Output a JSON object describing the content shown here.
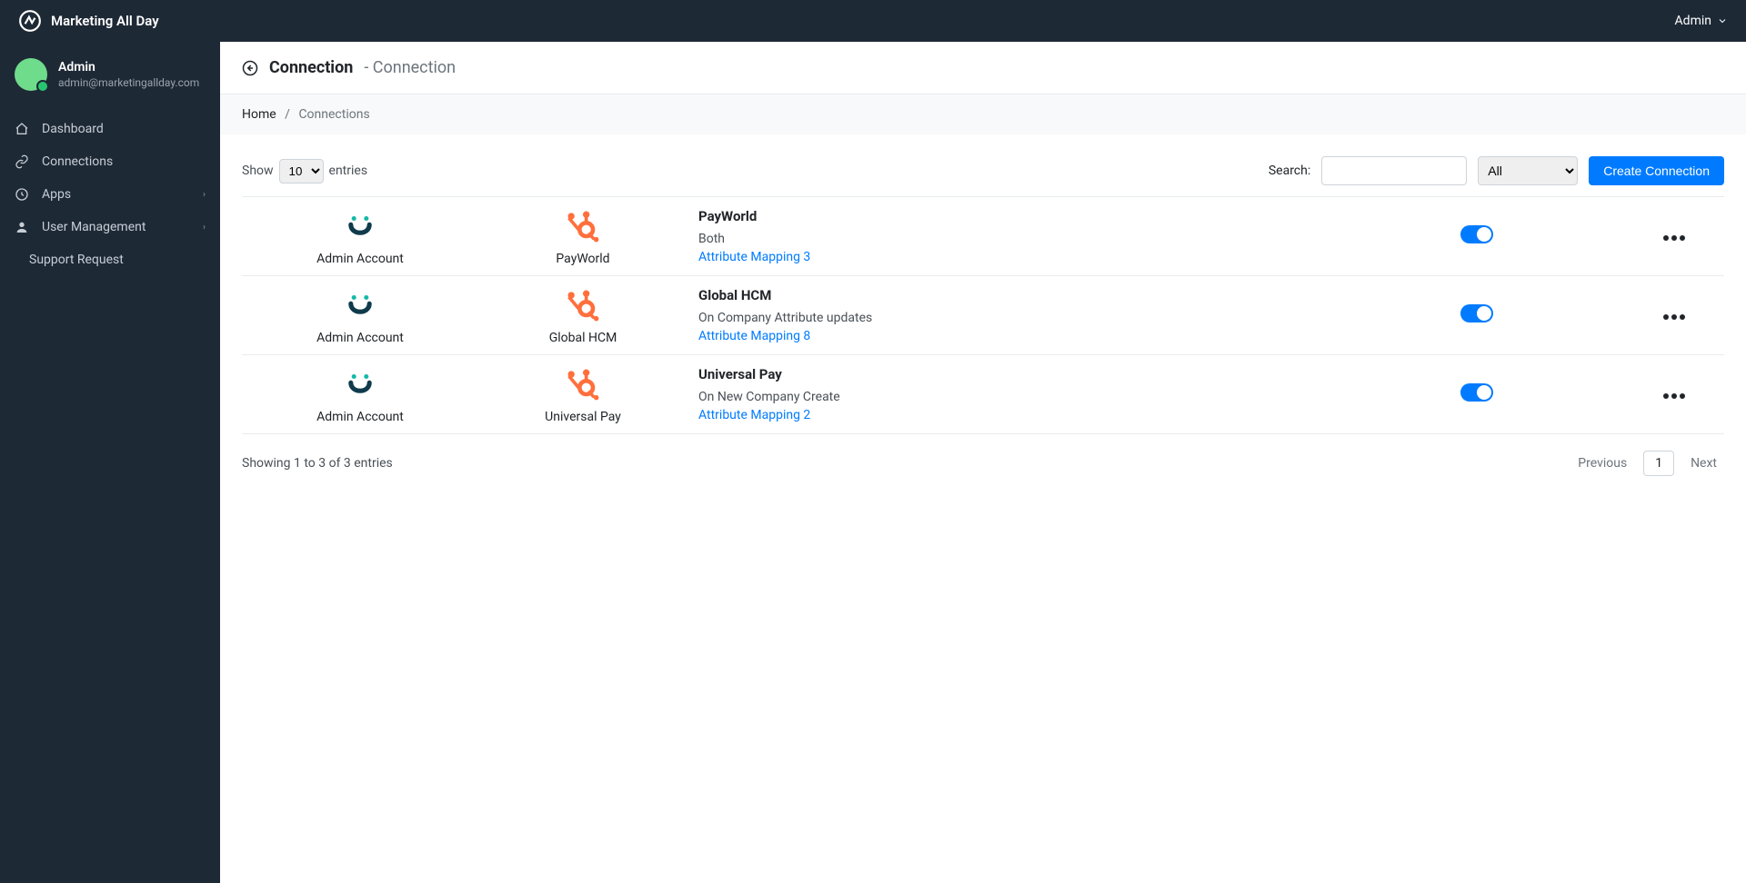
{
  "brand": {
    "name": "Marketing All Day"
  },
  "header_user": {
    "label": "Admin"
  },
  "user": {
    "name": "Admin",
    "email": "admin@marketingallday.com"
  },
  "sidebar": {
    "items": [
      {
        "label": "Dashboard",
        "icon": "home",
        "caret": false
      },
      {
        "label": "Connections",
        "icon": "link",
        "caret": false
      },
      {
        "label": "Apps",
        "icon": "apps",
        "caret": true
      },
      {
        "label": "User Management",
        "icon": "user",
        "caret": true
      },
      {
        "label": "Support Request",
        "icon": "",
        "caret": false,
        "indent": true
      }
    ]
  },
  "page": {
    "title": "Connection",
    "subtitle": "- Connection"
  },
  "breadcrumb": {
    "home": "Home",
    "sep": "/",
    "current": "Connections"
  },
  "controls": {
    "show_label": "Show",
    "entries_label": "entries",
    "page_size": "10",
    "search_label": "Search:",
    "filter_value": "All",
    "create_button": "Create Connection"
  },
  "rows": [
    {
      "account_label": "Admin Account",
      "target_label": "PayWorld",
      "title": "PayWorld",
      "trigger": "Both",
      "mapping": "Attribute Mapping 3",
      "enabled": true
    },
    {
      "account_label": "Admin Account",
      "target_label": "Global HCM",
      "title": "Global HCM",
      "trigger": "On Company Attribute updates",
      "mapping": "Attribute Mapping 8",
      "enabled": true
    },
    {
      "account_label": "Admin Account",
      "target_label": "Universal Pay",
      "title": "Universal Pay",
      "trigger": "On New Company Create",
      "mapping": "Attribute Mapping 2",
      "enabled": true
    }
  ],
  "footer": {
    "status": "Showing 1 to 3 of 3 entries",
    "prev": "Previous",
    "page": "1",
    "next": "Next"
  }
}
